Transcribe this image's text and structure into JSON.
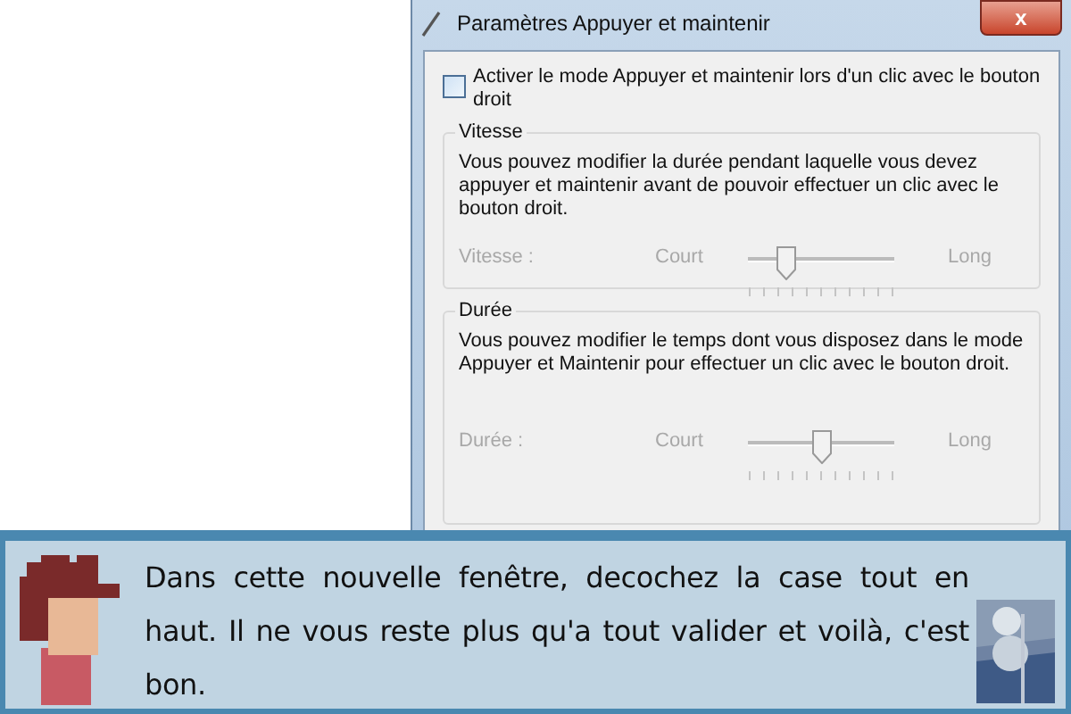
{
  "window": {
    "title": "Paramètres Appuyer et maintenir",
    "close": "x"
  },
  "checkbox": {
    "label": "Activer le mode Appuyer et maintenir lors d'un clic avec le bouton droit",
    "checked": false
  },
  "groups": [
    {
      "title": "Vitesse",
      "description": "Vous pouvez modifier la durée pendant laquelle vous devez appuyer et maintenir avant de pouvoir effectuer un clic avec le bouton droit.",
      "slider": {
        "label": "Vitesse :",
        "min_label": "Court",
        "max_label": "Long",
        "level": 0.25,
        "disabled": true
      }
    },
    {
      "title": "Durée",
      "description": "Vous pouvez modifier le temps dont vous disposez dans le mode Appuyer et Maintenir pour effectuer un clic avec le bouton droit.",
      "slider": {
        "label": "Durée :",
        "min_label": "Court",
        "max_label": "Long",
        "level": 0.5,
        "disabled": true
      }
    }
  ],
  "dialog": {
    "text": "Dans cette nouvelle fenêtre, decochez la case tout en haut. Il ne vous reste plus qu'a tout valider et voilà, c'est bon."
  }
}
